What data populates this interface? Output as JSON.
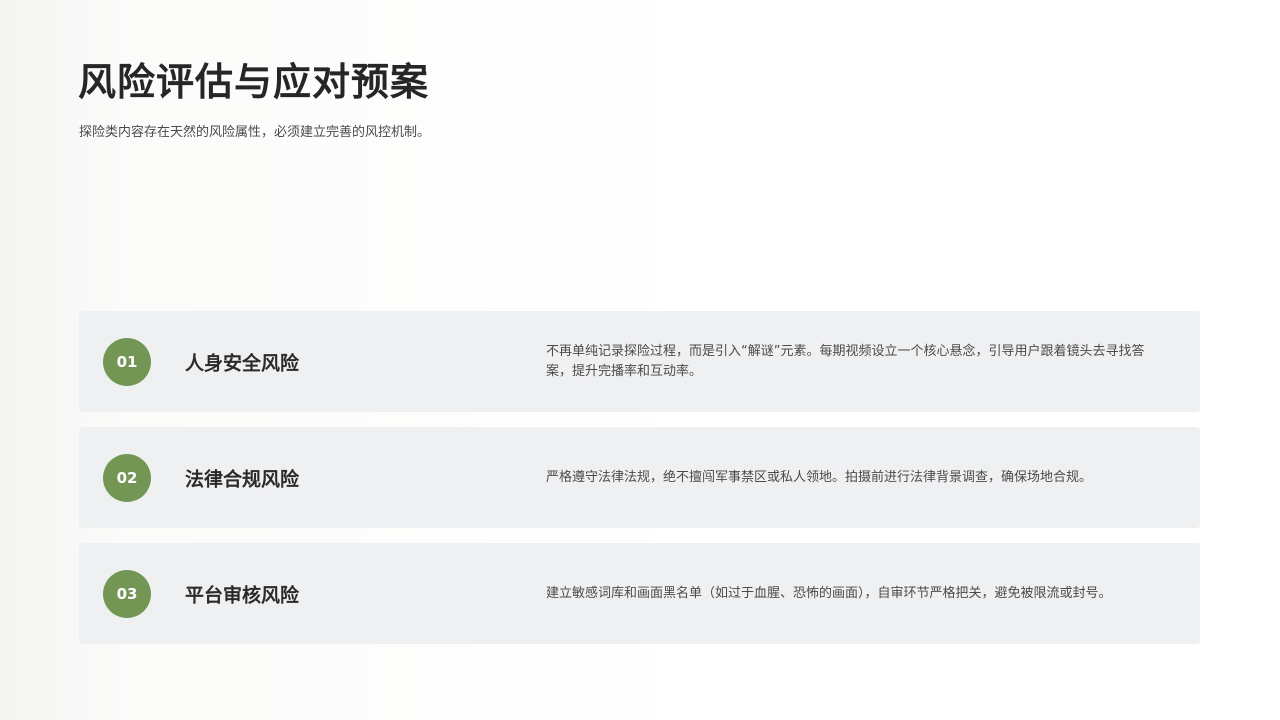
{
  "slide": {
    "title": "风险评估与应对预案",
    "subtitle": "探险类内容存在天然的风险属性，必须建立完善的风控机制。"
  },
  "risks": [
    {
      "number": "01",
      "name": "人身安全风险",
      "description": "不再单纯记录探险过程，而是引入“解谜”元素。每期视频设立一个核心悬念，引导用户跟着镜头去寻找答案，提升完播率和互动率。"
    },
    {
      "number": "02",
      "name": "法律合规风险",
      "description": "严格遵守法律法规，绝不擅闯军事禁区或私人领地。拍摄前进行法律背景调查，确保场地合规。"
    },
    {
      "number": "03",
      "name": "平台审核风险",
      "description": "建立敏感词库和画面黑名单（如过于血腥、恐怖的画面），自审环节严格把关，避免被限流或封号。"
    }
  ],
  "colors": {
    "accent": "#739655",
    "card_background": "#eff0f2",
    "title": "#262626",
    "body_text": "#4a4a4a"
  }
}
